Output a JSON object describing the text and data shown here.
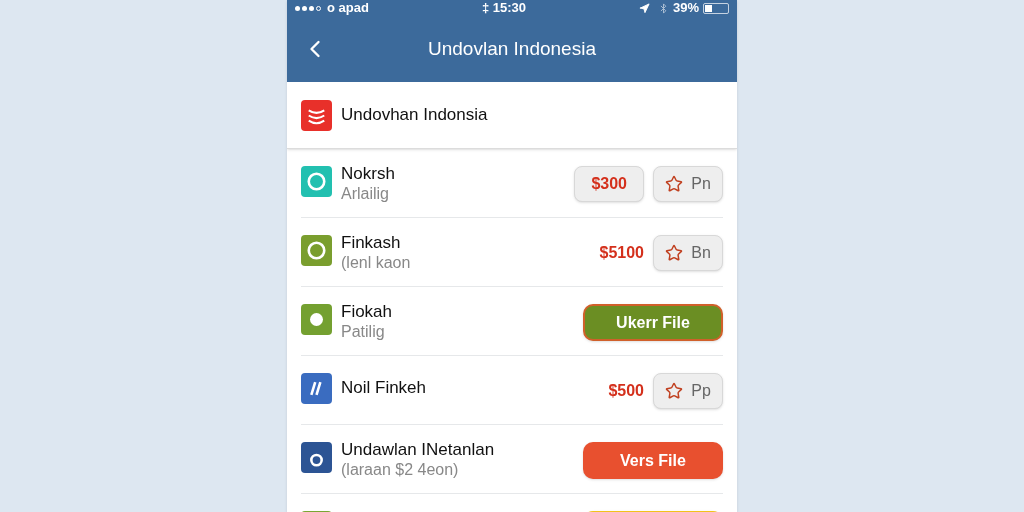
{
  "status_bar": {
    "carrier": "o apad",
    "time": "‡ 15:30",
    "battery": "39%"
  },
  "header": {
    "title": "Undovlan Indonesia"
  },
  "top_item": {
    "name": "Undovhan Indonsia",
    "color": "#e8302a"
  },
  "items": [
    {
      "kind": "price_pin",
      "name": "Nokrsh",
      "subtitle": "Arlailig",
      "price": "$300",
      "price_boxed": true,
      "pin": "Pn",
      "color": "#22c0b0"
    },
    {
      "kind": "price_pin",
      "name": "Finkash",
      "subtitle": "(lenl kaon",
      "price": "$5100",
      "price_boxed": false,
      "pin": "Bn",
      "color": "#7a9e2e"
    },
    {
      "kind": "confirm",
      "name": "Fiokah",
      "subtitle": "Patilig",
      "action": "Ukerr File",
      "color": "#74a030",
      "outlined": true
    },
    {
      "kind": "price_pin",
      "name": "Noil Finkeh",
      "price": "$500",
      "price_boxed": false,
      "pin": "Pp",
      "color": "#3a6cc0"
    },
    {
      "kind": "alert",
      "name": "Undawlan INetanlan",
      "subtitle": "(laraan $2 4eon)",
      "action": "Vers File",
      "color": "#2c5494",
      "outlined": false
    },
    {
      "kind": "pending",
      "color": "#7aa632",
      "outlined": false
    }
  ]
}
